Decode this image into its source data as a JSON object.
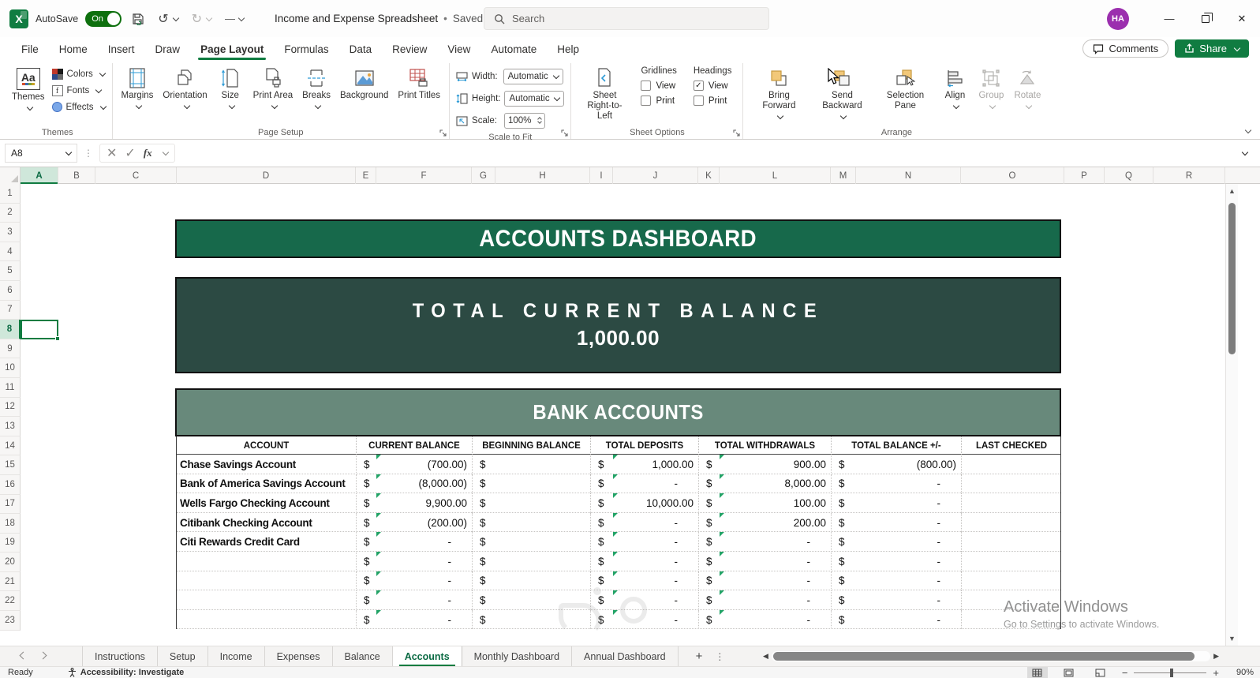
{
  "titlebar": {
    "autosave_label": "AutoSave",
    "autosave_state": "On",
    "doc_title": "Income and Expense Spreadsheet",
    "doc_separator": "•",
    "doc_status": "Saved",
    "search_placeholder": "Search",
    "avatar_initials": "HA"
  },
  "ribbon_tabs": [
    {
      "label": "File"
    },
    {
      "label": "Home"
    },
    {
      "label": "Insert"
    },
    {
      "label": "Draw"
    },
    {
      "label": "Page Layout",
      "active": true
    },
    {
      "label": "Formulas"
    },
    {
      "label": "Data"
    },
    {
      "label": "Review"
    },
    {
      "label": "View"
    },
    {
      "label": "Automate"
    },
    {
      "label": "Help"
    }
  ],
  "ribbon_actions": {
    "comments": "Comments",
    "share": "Share"
  },
  "ribbon": {
    "themes_group": {
      "label": "Themes",
      "themes_btn": "Themes",
      "themes_glyph": "Aa",
      "colors": "Colors",
      "fonts": "Fonts",
      "effects": "Effects"
    },
    "page_setup_group": {
      "label": "Page Setup",
      "margins": "Margins",
      "orientation": "Orientation",
      "size": "Size",
      "print_area": "Print Area",
      "breaks": "Breaks",
      "background": "Background",
      "print_titles": "Print Titles"
    },
    "scale_group": {
      "label": "Scale to Fit",
      "width_label": "Width:",
      "height_label": "Height:",
      "scale_label": "Scale:",
      "width_value": "Automatic",
      "height_value": "Automatic",
      "scale_value": "100%"
    },
    "sheet_options_group": {
      "label": "Sheet Options",
      "rtl": "Sheet Right-to-Left",
      "gridlines": "Gridlines",
      "headings": "Headings",
      "view": "View",
      "print": "Print",
      "gridlines_view": false,
      "gridlines_print": false,
      "headings_view": true,
      "headings_print": false
    },
    "arrange_group": {
      "label": "Arrange",
      "bring_forward": "Bring Forward",
      "send_backward": "Send Backward",
      "selection_pane": "Selection Pane",
      "align": "Align",
      "group": "Group",
      "rotate": "Rotate"
    }
  },
  "formula_bar": {
    "name_box": "A8",
    "fx": "fx",
    "content": ""
  },
  "grid": {
    "columns": [
      {
        "label": "A",
        "active": true
      },
      {
        "label": "B"
      },
      {
        "label": "C"
      },
      {
        "label": "D"
      },
      {
        "label": "E"
      },
      {
        "label": "F"
      },
      {
        "label": "G"
      },
      {
        "label": "H"
      },
      {
        "label": "I"
      },
      {
        "label": "J"
      },
      {
        "label": "K"
      },
      {
        "label": "L"
      },
      {
        "label": "M"
      },
      {
        "label": "N"
      },
      {
        "label": "O"
      },
      {
        "label": "P"
      },
      {
        "label": "Q"
      },
      {
        "label": "R"
      }
    ],
    "rows": [
      {
        "n": "1"
      },
      {
        "n": "2"
      },
      {
        "n": "3"
      },
      {
        "n": "4"
      },
      {
        "n": "5"
      },
      {
        "n": "6"
      },
      {
        "n": "7"
      },
      {
        "n": "8",
        "active": true
      },
      {
        "n": "9"
      },
      {
        "n": "10"
      },
      {
        "n": "11"
      },
      {
        "n": "12"
      },
      {
        "n": "13"
      },
      {
        "n": "14"
      },
      {
        "n": "15"
      },
      {
        "n": "16"
      },
      {
        "n": "17"
      },
      {
        "n": "18"
      },
      {
        "n": "19"
      },
      {
        "n": "20"
      },
      {
        "n": "21"
      },
      {
        "n": "22"
      },
      {
        "n": "23"
      }
    ],
    "banner_title": "ACCOUNTS DASHBOARD",
    "total_label": "TOTAL CURRENT BALANCE",
    "total_value": "1,000.00",
    "section_title": "BANK ACCOUNTS",
    "currency_symbol": "$",
    "table_headers": [
      "ACCOUNT",
      "CURRENT BALANCE",
      "BEGINNING BALANCE",
      "TOTAL DEPOSITS",
      "TOTAL WITHDRAWALS",
      "TOTAL BALANCE +/-",
      "LAST CHECKED"
    ],
    "table_rows": [
      {
        "account": "Chase Savings Account",
        "current": "(700.00)",
        "beginning": "",
        "deposits": "1,000.00",
        "withdrawals": "900.00",
        "balance": "(800.00)",
        "last_checked": ""
      },
      {
        "account": "Bank of America Savings Account",
        "current": "(8,000.00)",
        "beginning": "",
        "deposits": "-",
        "withdrawals": "8,000.00",
        "balance": "-",
        "last_checked": ""
      },
      {
        "account": "Wells Fargo Checking Account",
        "current": "9,900.00",
        "beginning": "",
        "deposits": "10,000.00",
        "withdrawals": "100.00",
        "balance": "-",
        "last_checked": ""
      },
      {
        "account": "Citibank Checking Account",
        "current": "(200.00)",
        "beginning": "",
        "deposits": "-",
        "withdrawals": "200.00",
        "balance": "-",
        "last_checked": ""
      },
      {
        "account": "Citi Rewards Credit Card",
        "current": "-",
        "beginning": "",
        "deposits": "-",
        "withdrawals": "-",
        "balance": "-",
        "last_checked": ""
      },
      {
        "account": "",
        "current": "-",
        "beginning": "",
        "deposits": "-",
        "withdrawals": "-",
        "balance": "-",
        "last_checked": ""
      },
      {
        "account": "",
        "current": "-",
        "beginning": "",
        "deposits": "-",
        "withdrawals": "-",
        "balance": "-",
        "last_checked": ""
      },
      {
        "account": "",
        "current": "-",
        "beginning": "",
        "deposits": "-",
        "withdrawals": "-",
        "balance": "-",
        "last_checked": ""
      },
      {
        "account": "",
        "current": "-",
        "beginning": "",
        "deposits": "-",
        "withdrawals": "-",
        "balance": "-",
        "last_checked": ""
      }
    ]
  },
  "sheet_tabs": {
    "tabs": [
      {
        "label": "Instructions"
      },
      {
        "label": "Setup"
      },
      {
        "label": "Income"
      },
      {
        "label": "Expenses"
      },
      {
        "label": "Balance"
      },
      {
        "label": "Accounts",
        "active": true
      },
      {
        "label": "Monthly Dashboard"
      },
      {
        "label": "Annual Dashboard"
      }
    ],
    "add_sheet": "+",
    "more": "⋮"
  },
  "status_bar": {
    "ready": "Ready",
    "accessibility": "Accessibility: Investigate",
    "zoom_level": "90%"
  },
  "watermark": {
    "line1": "Activate Windows",
    "line2": "Go to Settings to activate Windows."
  },
  "colors": {
    "excel_green": "#107C41",
    "autosave_green": "#0e700e",
    "banner_green": "#17694b",
    "banner_teal": "#2c4a43",
    "banner_sage": "#68897b",
    "indicator_green": "#21a366",
    "avatar_purple": "#9b2fae"
  }
}
